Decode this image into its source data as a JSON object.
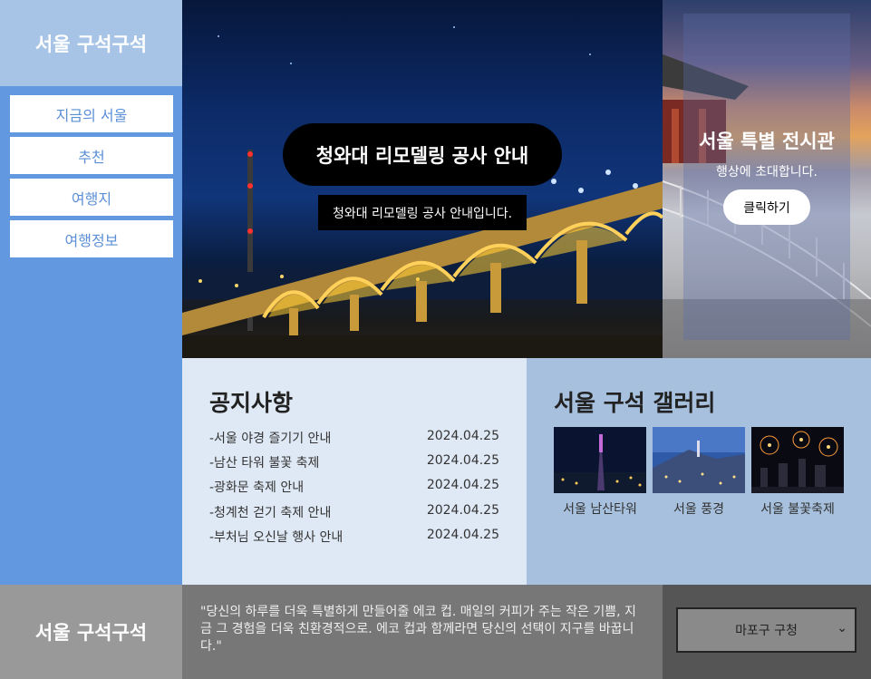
{
  "brand": {
    "title": "서울 구석구석"
  },
  "sidebar": {
    "items": [
      {
        "label": "지금의 서울"
      },
      {
        "label": "추천"
      },
      {
        "label": "여행지"
      },
      {
        "label": "여행정보"
      }
    ]
  },
  "hero": {
    "headline": "청와대 리모델링 공사 안내",
    "subtext": "청와대 리모델링 공사 안내입니다."
  },
  "promo": {
    "title": "서울 특별 전시관",
    "subtitle": "행상에 초대합니다.",
    "button_label": "클릭하기"
  },
  "notices": {
    "title": "공지사항",
    "items": [
      {
        "title": "-서울 야경 즐기기 안내",
        "date": "2024.04.25"
      },
      {
        "title": "-남산 타워 불꽃 축제",
        "date": "2024.04.25"
      },
      {
        "title": "-광화문 축제 안내",
        "date": "2024.04.25"
      },
      {
        "title": "-청계천 걷기 축제 안내",
        "date": "2024.04.25"
      },
      {
        "title": "-부처님 오신날 행사 안내",
        "date": "2024.04.25"
      }
    ]
  },
  "gallery": {
    "title": "서울 구석 갤러리",
    "items": [
      {
        "caption": "서울 남산타워"
      },
      {
        "caption": "서울 풍경"
      },
      {
        "caption": "서울 불꽃축제"
      }
    ]
  },
  "footer": {
    "brand": "서울 구석구석",
    "quote": "\"당신의 하루를 더욱 특별하게 만들어줄 에코 컵. 매일의 커피가 주는 작은 기쁨, 지금 그 경험을 더욱 친환경적으로. 에코 컵과 함께라면 당신의 선택이 지구를 바꿉니다.\"",
    "select_value": "마포구 구청"
  },
  "colors": {
    "sidebar": "#6198e0",
    "logo_bg": "#a7c4e6",
    "notices_bg": "#dfe9f5",
    "gallery_bg": "#a6c0de",
    "nav_text": "#5b8fd6"
  }
}
